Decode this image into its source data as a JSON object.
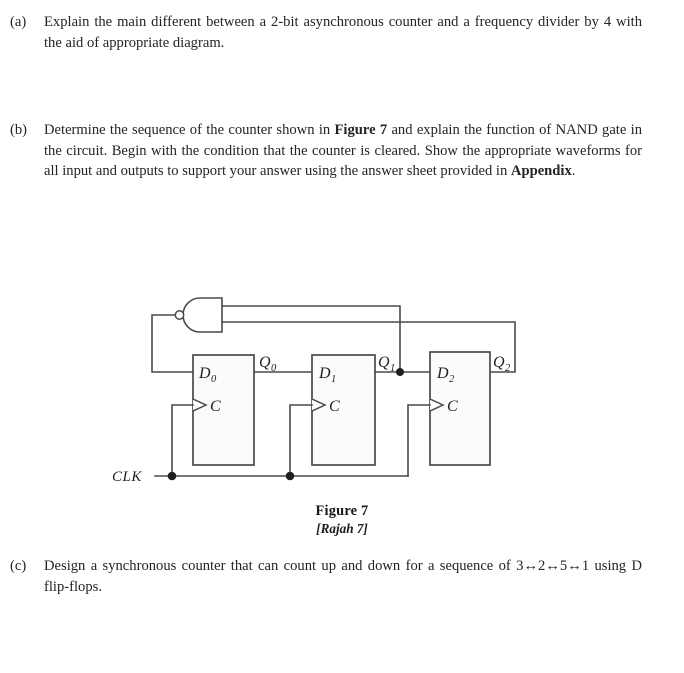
{
  "document": {
    "questions": [
      {
        "label": "(a)",
        "text": "Explain the main different between a 2-bit asynchronous counter and a frequency divider by 4 with the aid of appropriate diagram."
      },
      {
        "label": "(b)",
        "text_part1": "Determine the sequence of the counter shown in ",
        "bold1": "Figure 7",
        "text_part2": " and explain the function of NAND gate in the circuit. Begin with the condition that the counter is cleared. Show the appropriate waveforms for all input and outputs to support your answer using the answer sheet provided in ",
        "bold2": "Appendix",
        "text_part3": "."
      },
      {
        "label": "(c)",
        "text": "Design a synchronous counter that can count up and down for a sequence of 3↔2↔5↔1 using D flip-flops."
      }
    ],
    "figure": {
      "caption_main": "Figure 7",
      "caption_sub": "[Rajah 7]",
      "clock_label": "CLK",
      "gate": {
        "type": "nand-gate",
        "inputs": 2,
        "inverted_output": true
      },
      "flipflops": [
        {
          "d_label": "D",
          "d_sub": "0",
          "q_label": "Q",
          "q_sub": "0",
          "clock_label": "C"
        },
        {
          "d_label": "D",
          "d_sub": "1",
          "q_label": "Q",
          "q_sub": "1",
          "clock_label": "C"
        },
        {
          "d_label": "D",
          "d_sub": "2",
          "q_label": "Q",
          "q_sub": "2",
          "clock_label": "C"
        }
      ]
    },
    "colors": {
      "ink": "#242424",
      "wire": "#4a4a4a",
      "box_fill": "#fbfbfb",
      "page_bg": "#ffffff"
    }
  }
}
